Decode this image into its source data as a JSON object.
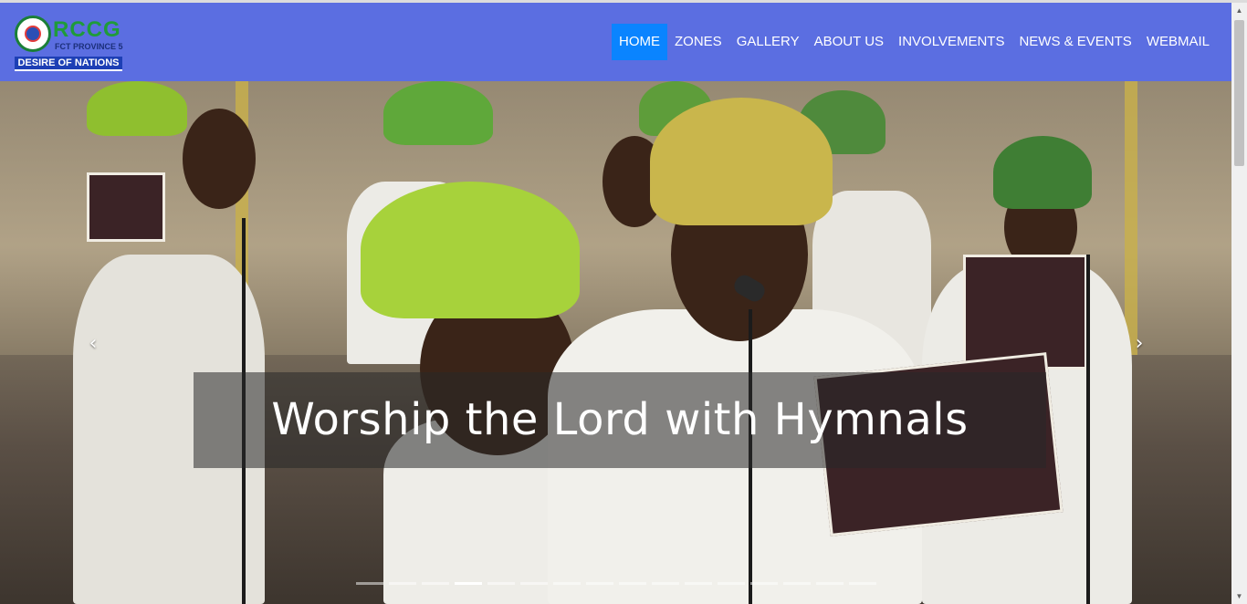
{
  "brand": {
    "logo_text": "RCCG",
    "logo_subtitle": "FCT PROVINCE 5",
    "logo_band": "DESIRE OF NATIONS"
  },
  "nav": {
    "items": [
      {
        "label": "HOME",
        "active": true
      },
      {
        "label": "ZONES",
        "active": false
      },
      {
        "label": "GALLERY",
        "active": false
      },
      {
        "label": "ABOUT US",
        "active": false
      },
      {
        "label": "INVOLVEMENTS",
        "active": false
      },
      {
        "label": "NEWS & EVENTS",
        "active": false
      },
      {
        "label": "WEBMAIL",
        "active": false
      }
    ]
  },
  "carousel": {
    "caption": "Worship the Lord with Hymnals",
    "prev_icon": "‹",
    "next_icon": "›",
    "slide_count": 16,
    "active_index": 3
  },
  "colors": {
    "navbar": "#5b6ee1",
    "active_nav": "#0a84ff"
  },
  "icons": {
    "prev": "chevron-left-icon",
    "next": "chevron-right-icon"
  }
}
